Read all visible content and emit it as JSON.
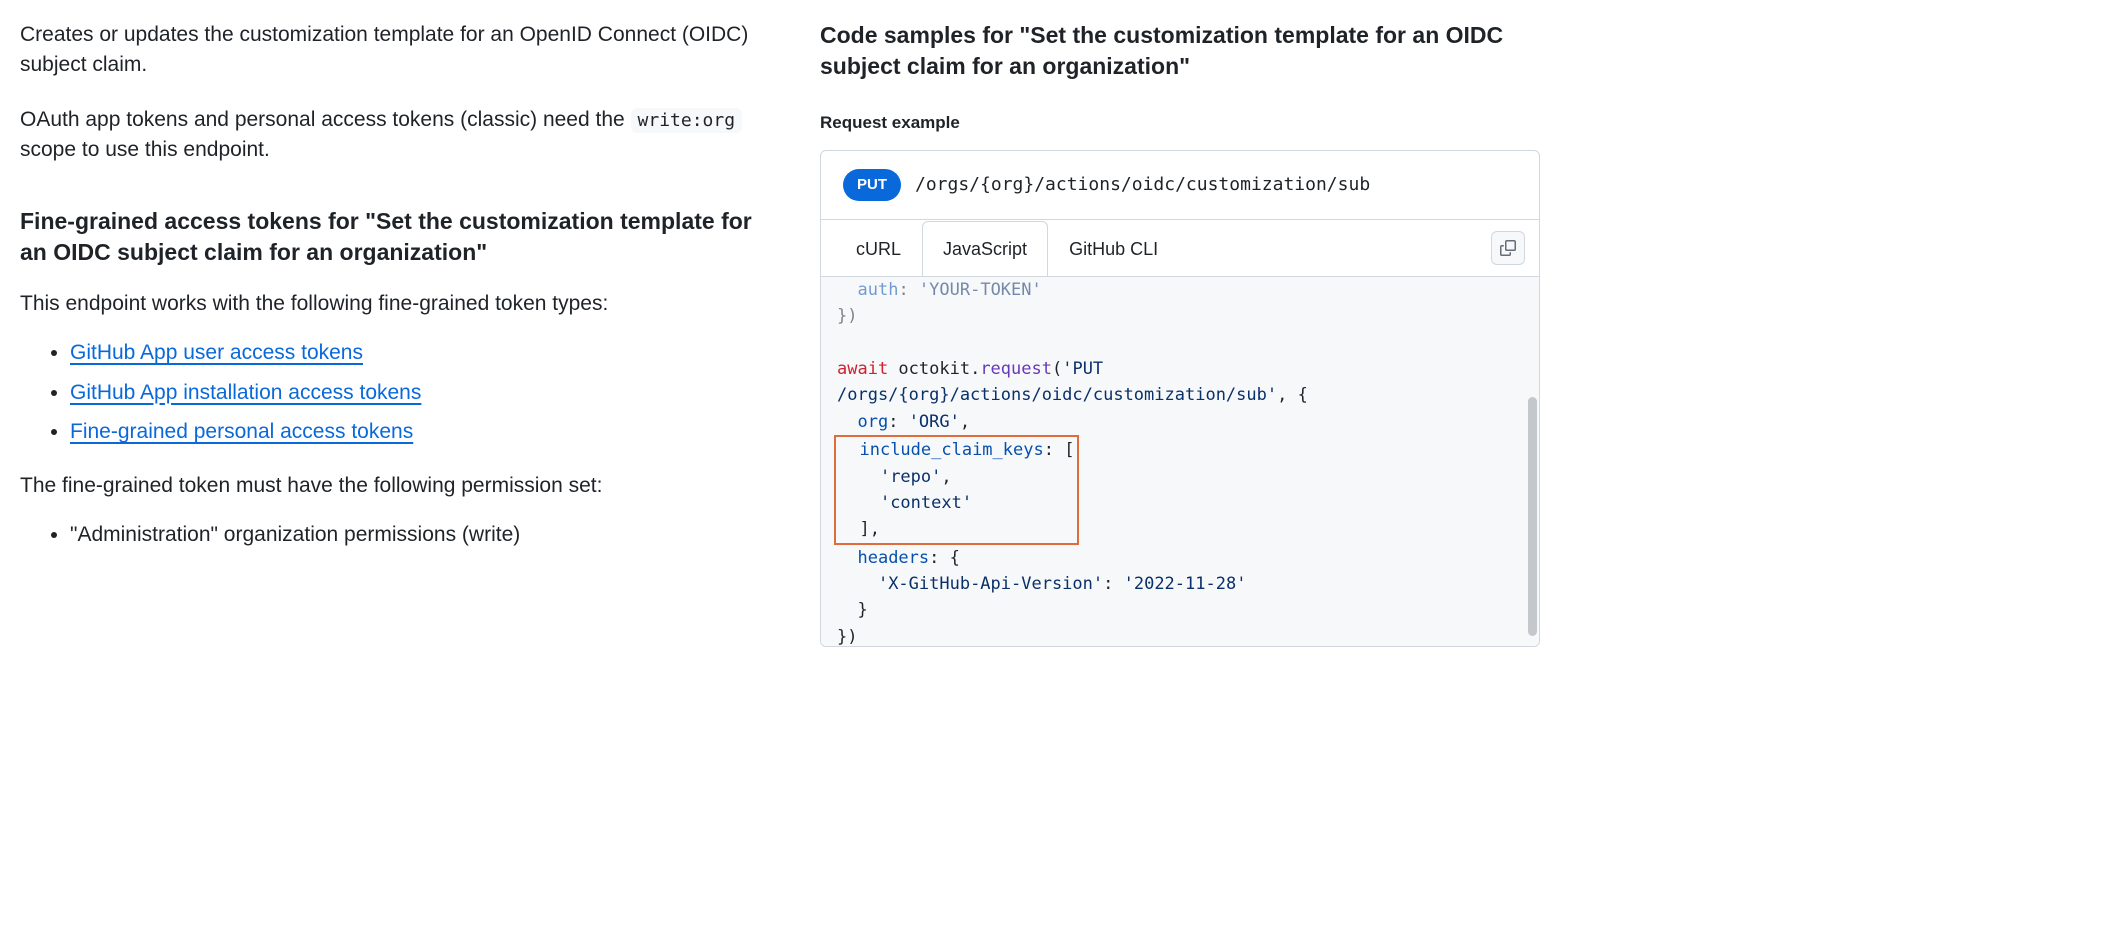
{
  "left": {
    "intro": "Creates or updates the customization template for an OpenID Connect (OIDC) subject claim.",
    "oauth_pre": "OAuth app tokens and personal access tokens (classic) need the ",
    "scope_code": "write:org",
    "oauth_post": " scope to use this endpoint.",
    "fine_grained_heading": "Fine-grained access tokens for \"Set the customization template for an OIDC subject claim for an organization\"",
    "token_types_intro": "This endpoint works with the following fine-grained token types:",
    "token_links": [
      "GitHub App user access tokens",
      "GitHub App installation access tokens",
      "Fine-grained personal access tokens"
    ],
    "perm_intro": "The fine-grained token must have the following permission set:",
    "perm_item": "\"Administration\" organization permissions (write)"
  },
  "right": {
    "heading": "Code samples for \"Set the customization template for an OIDC subject claim for an organization\"",
    "req_label": "Request example",
    "method": "PUT",
    "path": "/orgs/{org}/actions/oidc/customization/sub",
    "tabs": {
      "curl": "cURL",
      "js": "JavaScript",
      "cli": "GitHub CLI"
    },
    "code": {
      "auth_key": "auth",
      "auth_val": "'YOUR-TOKEN'",
      "close1": "})",
      "await": "await",
      "octokit": " octokit.",
      "request": "request",
      "req_open": "(",
      "req_str": "'PUT /orgs/{org}/actions/oidc/customization/sub'",
      "req_comma": ", {",
      "org_key": "org",
      "org_val": "'ORG'",
      "ick_key": "include_claim_keys",
      "ick_open": ": [",
      "ick_v1": "'repo'",
      "ick_v2": "'context'",
      "ick_close": "],",
      "headers_key": "headers",
      "headers_open": ": {",
      "h_key": "'X-GitHub-Api-Version'",
      "h_val": "'2022-11-28'",
      "h_close": "}",
      "final_close": "})"
    }
  }
}
